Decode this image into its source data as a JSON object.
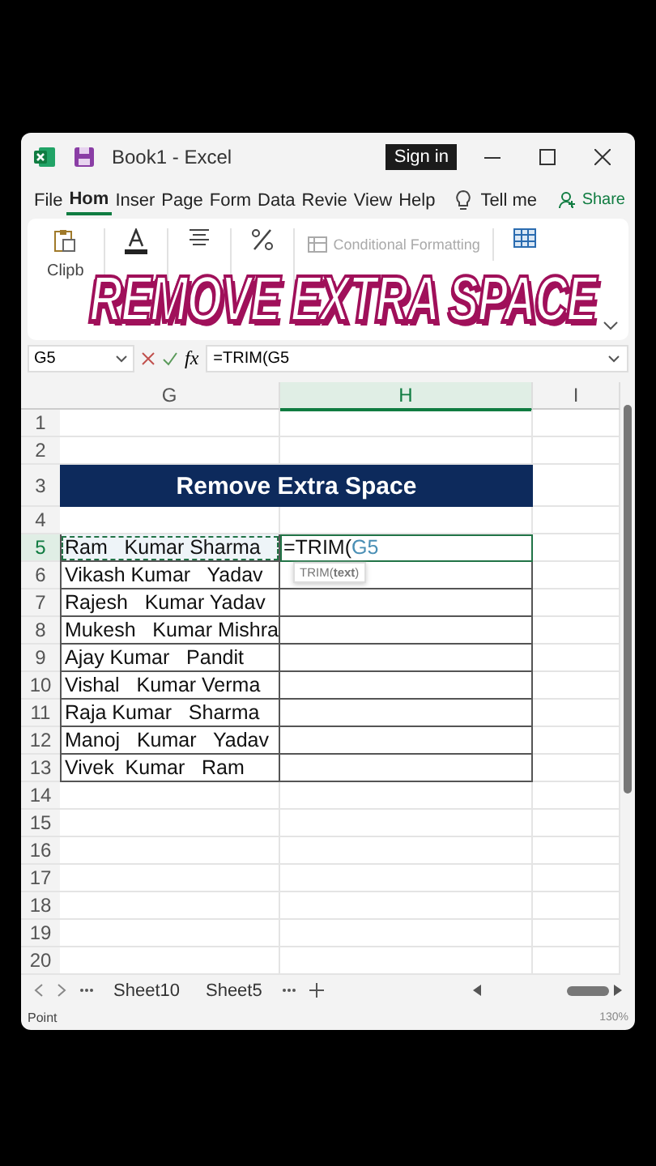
{
  "window": {
    "title": "Book1  -  Excel",
    "sign_in": "Sign in"
  },
  "menu": {
    "tabs": [
      {
        "label": "File",
        "selected": false
      },
      {
        "label": "Hom",
        "selected": true
      },
      {
        "label": "Inser",
        "selected": false
      },
      {
        "label": "Page",
        "selected": false
      },
      {
        "label": "Form",
        "selected": false
      },
      {
        "label": "Data",
        "selected": false
      },
      {
        "label": "Revie",
        "selected": false
      },
      {
        "label": "View",
        "selected": false
      },
      {
        "label": "Help",
        "selected": false
      }
    ],
    "tell_me": "Tell me",
    "share": "Share"
  },
  "ribbon": {
    "clipboard_label": "Clipb",
    "conditional_formatting": "Conditional Formatting",
    "caption": "REMOVE EXTRA SPACE"
  },
  "formula_bar": {
    "name_box": "G5",
    "fx": "fx",
    "formula": "=TRIM(G5"
  },
  "sheet": {
    "columns": [
      {
        "label": "G",
        "selected": false
      },
      {
        "label": "H",
        "selected": true
      },
      {
        "label": "I",
        "selected": false
      }
    ],
    "rows": [
      {
        "number": "1",
        "kind": "blank"
      },
      {
        "number": "2",
        "kind": "blank"
      },
      {
        "number": "3",
        "kind": "title",
        "text": "Remove Extra Space"
      },
      {
        "number": "4",
        "kind": "blank"
      },
      {
        "number": "5",
        "kind": "edit",
        "name": "Ram   Kumar Sharma",
        "formula_prefix": "=TRIM(",
        "formula_ref": "G5",
        "tooltip": "TRIM(**text**)"
      },
      {
        "number": "6",
        "kind": "name",
        "name": "Vikash Kumar   Yadav"
      },
      {
        "number": "7",
        "kind": "name",
        "name": "Rajesh   Kumar Yadav"
      },
      {
        "number": "8",
        "kind": "name",
        "name": "Mukesh   Kumar Mishra"
      },
      {
        "number": "9",
        "kind": "name",
        "name": "Ajay Kumar   Pandit"
      },
      {
        "number": "10",
        "kind": "name",
        "name": "Vishal   Kumar Verma"
      },
      {
        "number": "11",
        "kind": "name",
        "name": "Raja Kumar   Sharma"
      },
      {
        "number": "12",
        "kind": "name",
        "name": "Manoj   Kumar   Yadav"
      },
      {
        "number": "13",
        "kind": "name",
        "name": "Vivek  Kumar   Ram"
      },
      {
        "number": "14",
        "kind": "blank"
      },
      {
        "number": "15",
        "kind": "blank"
      },
      {
        "number": "16",
        "kind": "blank"
      },
      {
        "number": "17",
        "kind": "blank"
      },
      {
        "number": "18",
        "kind": "blank"
      },
      {
        "number": "19",
        "kind": "blank"
      },
      {
        "number": "20",
        "kind": "blank"
      }
    ]
  },
  "sheet_tabs": [
    {
      "label": "Sheet10",
      "selected": false
    },
    {
      "label": "Sheet5",
      "selected": false
    }
  ],
  "status_bar": {
    "mode": "Point",
    "zoom": "130%"
  }
}
